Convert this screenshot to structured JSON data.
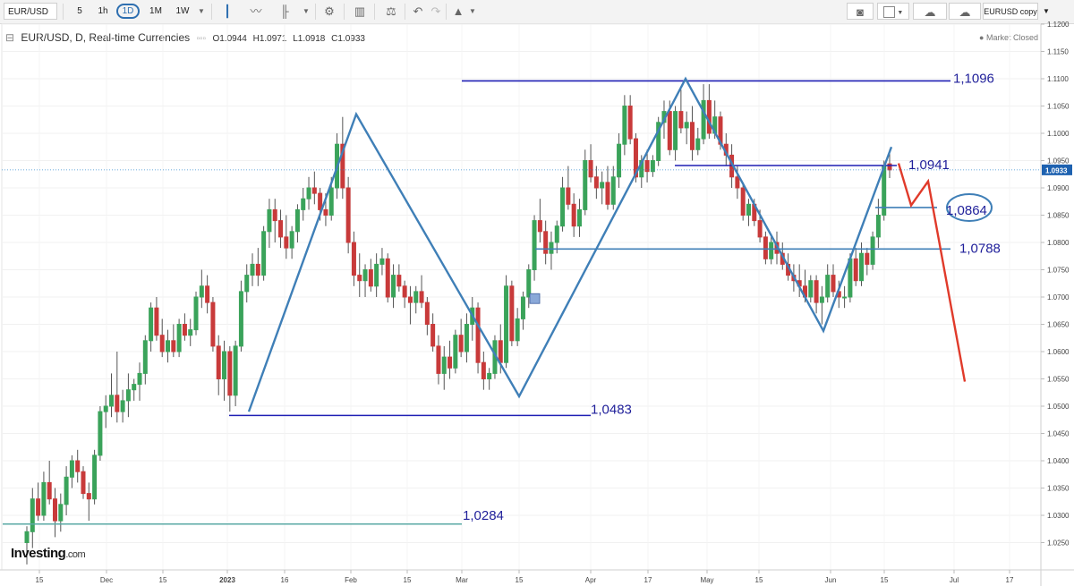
{
  "toolbar": {
    "symbol": "EUR/USD",
    "timeframes": [
      "5",
      "1h",
      "1D",
      "1M",
      "1W"
    ],
    "active_timeframe": "1D",
    "layout_name": "EURUSD copy",
    "icons": [
      "candlestick-icon",
      "line-chart-icon",
      "bar-chart-icon",
      "gear-icon",
      "indicators-icon",
      "scale-icon",
      "undo-icon",
      "redo-icon",
      "drawing-tools-icon",
      "camera-icon",
      "color-box-icon",
      "cloud-download-icon",
      "cloud-upload-icon"
    ]
  },
  "legend": {
    "symbol": "EUR/USD, D, Real-time Currencies",
    "open": "O1.0944",
    "high": "H1.0971",
    "low": "L1.0918",
    "close": "C1.0933"
  },
  "status": "Market Closed",
  "logo": {
    "brand": "Investing",
    "suffix": ".com"
  },
  "chart_data": {
    "type": "candlestick",
    "symbol": "EUR/USD",
    "interval": "D",
    "ylim": [
      1.02,
      1.115
    ],
    "y_ticks": [
      "1.1200",
      "1.1150",
      "1.1100",
      "1.1050",
      "1.1000",
      "1.0950",
      "1.0900",
      "1.0850",
      "1.0800",
      "1.0750",
      "1.0700",
      "1.0650",
      "1.0600",
      "1.0550",
      "1.0500",
      "1.0450",
      "1.0400",
      "1.0350",
      "1.0300",
      "1.0250"
    ],
    "x_ticks": [
      "15",
      "Dec",
      "15",
      "2023",
      "16",
      "Feb",
      "15",
      "Mar",
      "15",
      "Apr",
      "17",
      "May",
      "15",
      "Jun",
      "15",
      "Jul",
      "17"
    ],
    "last_price": "1.0933",
    "price_line_color": "#3b8fd1",
    "colors": {
      "up": "#3aa35a",
      "down": "#c83a3a",
      "level": "#1f1fb4",
      "pattern": "#3f7fb7",
      "projection": "#e03a2a"
    },
    "candles": [
      {
        "o": 1.025,
        "h": 1.028,
        "l": 1.021,
        "c": 1.027
      },
      {
        "o": 1.027,
        "h": 1.035,
        "l": 1.024,
        "c": 1.033
      },
      {
        "o": 1.033,
        "h": 1.036,
        "l": 1.029,
        "c": 1.03
      },
      {
        "o": 1.03,
        "h": 1.038,
        "l": 1.029,
        "c": 1.036
      },
      {
        "o": 1.036,
        "h": 1.04,
        "l": 1.032,
        "c": 1.033
      },
      {
        "o": 1.033,
        "h": 1.035,
        "l": 1.026,
        "c": 1.029
      },
      {
        "o": 1.029,
        "h": 1.034,
        "l": 1.027,
        "c": 1.032
      },
      {
        "o": 1.032,
        "h": 1.039,
        "l": 1.03,
        "c": 1.037
      },
      {
        "o": 1.037,
        "h": 1.041,
        "l": 1.035,
        "c": 1.04
      },
      {
        "o": 1.04,
        "h": 1.042,
        "l": 1.036,
        "c": 1.038
      },
      {
        "o": 1.038,
        "h": 1.039,
        "l": 1.033,
        "c": 1.034
      },
      {
        "o": 1.034,
        "h": 1.036,
        "l": 1.029,
        "c": 1.033
      },
      {
        "o": 1.033,
        "h": 1.042,
        "l": 1.032,
        "c": 1.041
      },
      {
        "o": 1.041,
        "h": 1.05,
        "l": 1.04,
        "c": 1.049
      },
      {
        "o": 1.049,
        "h": 1.052,
        "l": 1.046,
        "c": 1.05
      },
      {
        "o": 1.05,
        "h": 1.056,
        "l": 1.048,
        "c": 1.052
      },
      {
        "o": 1.052,
        "h": 1.06,
        "l": 1.047,
        "c": 1.049
      },
      {
        "o": 1.049,
        "h": 1.053,
        "l": 1.047,
        "c": 1.051
      },
      {
        "o": 1.051,
        "h": 1.056,
        "l": 1.048,
        "c": 1.053
      },
      {
        "o": 1.053,
        "h": 1.055,
        "l": 1.051,
        "c": 1.054
      },
      {
        "o": 1.054,
        "h": 1.058,
        "l": 1.051,
        "c": 1.056
      },
      {
        "o": 1.056,
        "h": 1.063,
        "l": 1.054,
        "c": 1.062
      },
      {
        "o": 1.062,
        "h": 1.069,
        "l": 1.06,
        "c": 1.068
      },
      {
        "o": 1.068,
        "h": 1.07,
        "l": 1.062,
        "c": 1.063
      },
      {
        "o": 1.063,
        "h": 1.066,
        "l": 1.059,
        "c": 1.06
      },
      {
        "o": 1.06,
        "h": 1.064,
        "l": 1.058,
        "c": 1.062
      },
      {
        "o": 1.062,
        "h": 1.065,
        "l": 1.059,
        "c": 1.06
      },
      {
        "o": 1.06,
        "h": 1.066,
        "l": 1.059,
        "c": 1.065
      },
      {
        "o": 1.065,
        "h": 1.067,
        "l": 1.062,
        "c": 1.063
      },
      {
        "o": 1.063,
        "h": 1.066,
        "l": 1.061,
        "c": 1.064
      },
      {
        "o": 1.064,
        "h": 1.071,
        "l": 1.063,
        "c": 1.07
      },
      {
        "o": 1.07,
        "h": 1.075,
        "l": 1.068,
        "c": 1.072
      },
      {
        "o": 1.072,
        "h": 1.074,
        "l": 1.067,
        "c": 1.069
      },
      {
        "o": 1.069,
        "h": 1.07,
        "l": 1.06,
        "c": 1.061
      },
      {
        "o": 1.061,
        "h": 1.063,
        "l": 1.052,
        "c": 1.055
      },
      {
        "o": 1.055,
        "h": 1.062,
        "l": 1.051,
        "c": 1.06
      },
      {
        "o": 1.06,
        "h": 1.061,
        "l": 1.049,
        "c": 1.052
      },
      {
        "o": 1.052,
        "h": 1.062,
        "l": 1.05,
        "c": 1.061
      },
      {
        "o": 1.061,
        "h": 1.073,
        "l": 1.06,
        "c": 1.071
      },
      {
        "o": 1.071,
        "h": 1.076,
        "l": 1.069,
        "c": 1.074
      },
      {
        "o": 1.074,
        "h": 1.078,
        "l": 1.072,
        "c": 1.076
      },
      {
        "o": 1.076,
        "h": 1.079,
        "l": 1.072,
        "c": 1.074
      },
      {
        "o": 1.074,
        "h": 1.083,
        "l": 1.073,
        "c": 1.082
      },
      {
        "o": 1.082,
        "h": 1.088,
        "l": 1.079,
        "c": 1.086
      },
      {
        "o": 1.086,
        "h": 1.088,
        "l": 1.08,
        "c": 1.084
      },
      {
        "o": 1.084,
        "h": 1.086,
        "l": 1.079,
        "c": 1.081
      },
      {
        "o": 1.081,
        "h": 1.085,
        "l": 1.077,
        "c": 1.079
      },
      {
        "o": 1.079,
        "h": 1.083,
        "l": 1.077,
        "c": 1.082
      },
      {
        "o": 1.082,
        "h": 1.087,
        "l": 1.08,
        "c": 1.086
      },
      {
        "o": 1.086,
        "h": 1.09,
        "l": 1.084,
        "c": 1.088
      },
      {
        "o": 1.088,
        "h": 1.092,
        "l": 1.086,
        "c": 1.09
      },
      {
        "o": 1.09,
        "h": 1.093,
        "l": 1.087,
        "c": 1.089
      },
      {
        "o": 1.089,
        "h": 1.09,
        "l": 1.084,
        "c": 1.086
      },
      {
        "o": 1.086,
        "h": 1.089,
        "l": 1.083,
        "c": 1.085
      },
      {
        "o": 1.085,
        "h": 1.092,
        "l": 1.084,
        "c": 1.09
      },
      {
        "o": 1.09,
        "h": 1.1,
        "l": 1.088,
        "c": 1.098
      },
      {
        "o": 1.098,
        "h": 1.103,
        "l": 1.088,
        "c": 1.09
      },
      {
        "o": 1.09,
        "h": 1.092,
        "l": 1.078,
        "c": 1.08
      },
      {
        "o": 1.08,
        "h": 1.082,
        "l": 1.072,
        "c": 1.074
      },
      {
        "o": 1.074,
        "h": 1.078,
        "l": 1.07,
        "c": 1.073
      },
      {
        "o": 1.073,
        "h": 1.076,
        "l": 1.07,
        "c": 1.075
      },
      {
        "o": 1.075,
        "h": 1.077,
        "l": 1.071,
        "c": 1.072
      },
      {
        "o": 1.072,
        "h": 1.078,
        "l": 1.07,
        "c": 1.076
      },
      {
        "o": 1.076,
        "h": 1.079,
        "l": 1.074,
        "c": 1.077
      },
      {
        "o": 1.077,
        "h": 1.078,
        "l": 1.069,
        "c": 1.07
      },
      {
        "o": 1.07,
        "h": 1.076,
        "l": 1.068,
        "c": 1.074
      },
      {
        "o": 1.074,
        "h": 1.076,
        "l": 1.071,
        "c": 1.072
      },
      {
        "o": 1.072,
        "h": 1.073,
        "l": 1.068,
        "c": 1.07
      },
      {
        "o": 1.07,
        "h": 1.072,
        "l": 1.065,
        "c": 1.069
      },
      {
        "o": 1.069,
        "h": 1.072,
        "l": 1.067,
        "c": 1.071
      },
      {
        "o": 1.071,
        "h": 1.074,
        "l": 1.068,
        "c": 1.069
      },
      {
        "o": 1.069,
        "h": 1.07,
        "l": 1.063,
        "c": 1.065
      },
      {
        "o": 1.065,
        "h": 1.067,
        "l": 1.06,
        "c": 1.061
      },
      {
        "o": 1.061,
        "h": 1.063,
        "l": 1.054,
        "c": 1.056
      },
      {
        "o": 1.056,
        "h": 1.061,
        "l": 1.053,
        "c": 1.059
      },
      {
        "o": 1.059,
        "h": 1.062,
        "l": 1.055,
        "c": 1.057
      },
      {
        "o": 1.057,
        "h": 1.064,
        "l": 1.056,
        "c": 1.063
      },
      {
        "o": 1.063,
        "h": 1.066,
        "l": 1.059,
        "c": 1.06
      },
      {
        "o": 1.06,
        "h": 1.067,
        "l": 1.058,
        "c": 1.065
      },
      {
        "o": 1.065,
        "h": 1.07,
        "l": 1.062,
        "c": 1.068
      },
      {
        "o": 1.068,
        "h": 1.069,
        "l": 1.056,
        "c": 1.058
      },
      {
        "o": 1.058,
        "h": 1.06,
        "l": 1.053,
        "c": 1.055
      },
      {
        "o": 1.055,
        "h": 1.057,
        "l": 1.053,
        "c": 1.056
      },
      {
        "o": 1.056,
        "h": 1.063,
        "l": 1.055,
        "c": 1.062
      },
      {
        "o": 1.062,
        "h": 1.065,
        "l": 1.056,
        "c": 1.058
      },
      {
        "o": 1.058,
        "h": 1.074,
        "l": 1.057,
        "c": 1.072
      },
      {
        "o": 1.072,
        "h": 1.073,
        "l": 1.061,
        "c": 1.062
      },
      {
        "o": 1.062,
        "h": 1.068,
        "l": 1.061,
        "c": 1.066
      },
      {
        "o": 1.066,
        "h": 1.071,
        "l": 1.064,
        "c": 1.07
      },
      {
        "o": 1.07,
        "h": 1.076,
        "l": 1.068,
        "c": 1.075
      },
      {
        "o": 1.075,
        "h": 1.085,
        "l": 1.073,
        "c": 1.084
      },
      {
        "o": 1.084,
        "h": 1.088,
        "l": 1.08,
        "c": 1.082
      },
      {
        "o": 1.082,
        "h": 1.084,
        "l": 1.076,
        "c": 1.078
      },
      {
        "o": 1.078,
        "h": 1.082,
        "l": 1.075,
        "c": 1.08
      },
      {
        "o": 1.08,
        "h": 1.084,
        "l": 1.078,
        "c": 1.083
      },
      {
        "o": 1.083,
        "h": 1.092,
        "l": 1.082,
        "c": 1.09
      },
      {
        "o": 1.09,
        "h": 1.094,
        "l": 1.086,
        "c": 1.087
      },
      {
        "o": 1.087,
        "h": 1.089,
        "l": 1.081,
        "c": 1.083
      },
      {
        "o": 1.083,
        "h": 1.088,
        "l": 1.081,
        "c": 1.086
      },
      {
        "o": 1.086,
        "h": 1.097,
        "l": 1.085,
        "c": 1.095
      },
      {
        "o": 1.095,
        "h": 1.098,
        "l": 1.091,
        "c": 1.092
      },
      {
        "o": 1.092,
        "h": 1.094,
        "l": 1.088,
        "c": 1.09
      },
      {
        "o": 1.09,
        "h": 1.093,
        "l": 1.087,
        "c": 1.091
      },
      {
        "o": 1.091,
        "h": 1.094,
        "l": 1.086,
        "c": 1.087
      },
      {
        "o": 1.087,
        "h": 1.094,
        "l": 1.086,
        "c": 1.092
      },
      {
        "o": 1.092,
        "h": 1.1,
        "l": 1.09,
        "c": 1.098
      },
      {
        "o": 1.098,
        "h": 1.107,
        "l": 1.096,
        "c": 1.105
      },
      {
        "o": 1.105,
        "h": 1.107,
        "l": 1.098,
        "c": 1.099
      },
      {
        "o": 1.099,
        "h": 1.1,
        "l": 1.091,
        "c": 1.092
      },
      {
        "o": 1.092,
        "h": 1.096,
        "l": 1.09,
        "c": 1.095
      },
      {
        "o": 1.095,
        "h": 1.097,
        "l": 1.091,
        "c": 1.093
      },
      {
        "o": 1.093,
        "h": 1.096,
        "l": 1.092,
        "c": 1.095
      },
      {
        "o": 1.095,
        "h": 1.103,
        "l": 1.094,
        "c": 1.102
      },
      {
        "o": 1.102,
        "h": 1.106,
        "l": 1.099,
        "c": 1.104
      },
      {
        "o": 1.104,
        "h": 1.106,
        "l": 1.096,
        "c": 1.097
      },
      {
        "o": 1.097,
        "h": 1.105,
        "l": 1.095,
        "c": 1.104
      },
      {
        "o": 1.104,
        "h": 1.108,
        "l": 1.1,
        "c": 1.101
      },
      {
        "o": 1.101,
        "h": 1.104,
        "l": 1.098,
        "c": 1.102
      },
      {
        "o": 1.102,
        "h": 1.105,
        "l": 1.095,
        "c": 1.097
      },
      {
        "o": 1.097,
        "h": 1.101,
        "l": 1.096,
        "c": 1.099
      },
      {
        "o": 1.099,
        "h": 1.109,
        "l": 1.098,
        "c": 1.106
      },
      {
        "o": 1.106,
        "h": 1.109,
        "l": 1.099,
        "c": 1.1
      },
      {
        "o": 1.1,
        "h": 1.106,
        "l": 1.099,
        "c": 1.103
      },
      {
        "o": 1.103,
        "h": 1.104,
        "l": 1.097,
        "c": 1.098
      },
      {
        "o": 1.098,
        "h": 1.1,
        "l": 1.094,
        "c": 1.096
      },
      {
        "o": 1.096,
        "h": 1.098,
        "l": 1.09,
        "c": 1.092
      },
      {
        "o": 1.092,
        "h": 1.094,
        "l": 1.088,
        "c": 1.09
      },
      {
        "o": 1.09,
        "h": 1.091,
        "l": 1.084,
        "c": 1.085
      },
      {
        "o": 1.085,
        "h": 1.088,
        "l": 1.083,
        "c": 1.087
      },
      {
        "o": 1.087,
        "h": 1.088,
        "l": 1.083,
        "c": 1.084
      },
      {
        "o": 1.084,
        "h": 1.086,
        "l": 1.08,
        "c": 1.081
      },
      {
        "o": 1.081,
        "h": 1.082,
        "l": 1.076,
        "c": 1.077
      },
      {
        "o": 1.077,
        "h": 1.081,
        "l": 1.076,
        "c": 1.08
      },
      {
        "o": 1.08,
        "h": 1.082,
        "l": 1.076,
        "c": 1.078
      },
      {
        "o": 1.078,
        "h": 1.08,
        "l": 1.075,
        "c": 1.076
      },
      {
        "o": 1.076,
        "h": 1.078,
        "l": 1.073,
        "c": 1.074
      },
      {
        "o": 1.074,
        "h": 1.076,
        "l": 1.071,
        "c": 1.073
      },
      {
        "o": 1.073,
        "h": 1.076,
        "l": 1.07,
        "c": 1.072
      },
      {
        "o": 1.072,
        "h": 1.075,
        "l": 1.069,
        "c": 1.07
      },
      {
        "o": 1.07,
        "h": 1.074,
        "l": 1.069,
        "c": 1.073
      },
      {
        "o": 1.073,
        "h": 1.074,
        "l": 1.067,
        "c": 1.069
      },
      {
        "o": 1.069,
        "h": 1.072,
        "l": 1.065,
        "c": 1.07
      },
      {
        "o": 1.07,
        "h": 1.076,
        "l": 1.069,
        "c": 1.074
      },
      {
        "o": 1.074,
        "h": 1.076,
        "l": 1.07,
        "c": 1.071
      },
      {
        "o": 1.071,
        "h": 1.073,
        "l": 1.068,
        "c": 1.07
      },
      {
        "o": 1.07,
        "h": 1.072,
        "l": 1.068,
        "c": 1.07
      },
      {
        "o": 1.07,
        "h": 1.078,
        "l": 1.069,
        "c": 1.077
      },
      {
        "o": 1.077,
        "h": 1.079,
        "l": 1.072,
        "c": 1.073
      },
      {
        "o": 1.073,
        "h": 1.08,
        "l": 1.072,
        "c": 1.078
      },
      {
        "o": 1.078,
        "h": 1.079,
        "l": 1.074,
        "c": 1.076
      },
      {
        "o": 1.076,
        "h": 1.082,
        "l": 1.075,
        "c": 1.081
      },
      {
        "o": 1.081,
        "h": 1.088,
        "l": 1.079,
        "c": 1.085
      },
      {
        "o": 1.085,
        "h": 1.095,
        "l": 1.084,
        "c": 1.094
      },
      {
        "o": 1.0944,
        "h": 1.0971,
        "l": 1.0918,
        "c": 1.0933
      }
    ],
    "levels": [
      {
        "label": "1,1096",
        "value": 1.1096
      },
      {
        "label": "1,0941",
        "value": 1.0941
      },
      {
        "label": "1,0864",
        "value": 1.0864
      },
      {
        "label": "1,0788",
        "value": 1.0788
      },
      {
        "label": "1,0483",
        "value": 1.0483
      },
      {
        "label": "1,0284",
        "value": 1.0284
      }
    ],
    "annotations": [
      "zigzag double-top pattern lines",
      "red bearish projection path"
    ]
  }
}
